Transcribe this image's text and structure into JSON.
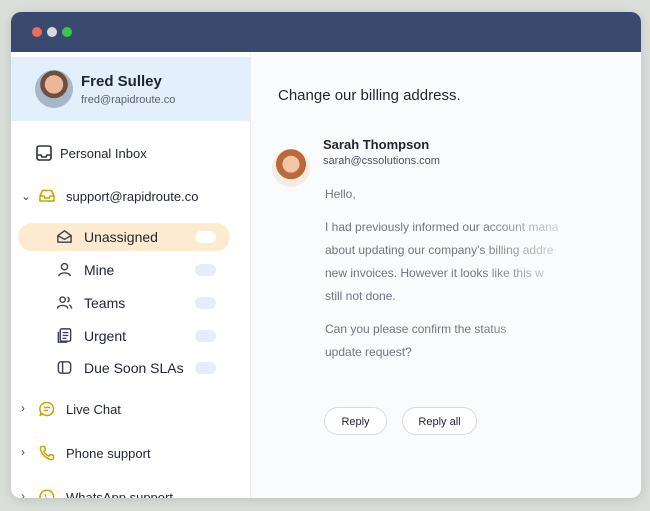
{
  "profile": {
    "name": "Fred Sulley",
    "email": "fred@rapidroute.co"
  },
  "sidebar": {
    "personal_inbox": "Personal Inbox",
    "group": {
      "label": "support@rapidroute.co",
      "items": [
        {
          "label": "Unassigned",
          "icon": "envelope-open-icon",
          "active": true
        },
        {
          "label": "Mine",
          "icon": "user-icon",
          "active": false
        },
        {
          "label": "Teams",
          "icon": "users-icon",
          "active": false
        },
        {
          "label": "Urgent",
          "icon": "documents-icon",
          "active": false
        },
        {
          "label": "Due Soon SLAs",
          "icon": "half-square-icon",
          "active": false
        }
      ]
    },
    "channels": [
      {
        "label": "Live Chat",
        "icon": "chat-bubble-icon"
      },
      {
        "label": "Phone support",
        "icon": "phone-icon"
      },
      {
        "label": "WhatsApp support",
        "icon": "whatsapp-icon"
      }
    ]
  },
  "message": {
    "subject": "Change our billing address.",
    "sender_name": "Sarah Thompson",
    "sender_email": "sarah@cssolutions.com",
    "greeting": "Hello,",
    "paragraph1": [
      "I had previously informed our account mana",
      "about updating our company's billing addre",
      "new invoices. However it looks like this w",
      "still not done."
    ],
    "paragraph2": [
      "Can you please confirm the status",
      "update request?"
    ],
    "reply_label": "Reply",
    "reply_all_label": "Reply all"
  },
  "colors": {
    "titlebar": "#3a4a6e",
    "active_item": "#fdebd0",
    "profile_bg": "#e3effa",
    "channel_icon": "#c9a400"
  }
}
